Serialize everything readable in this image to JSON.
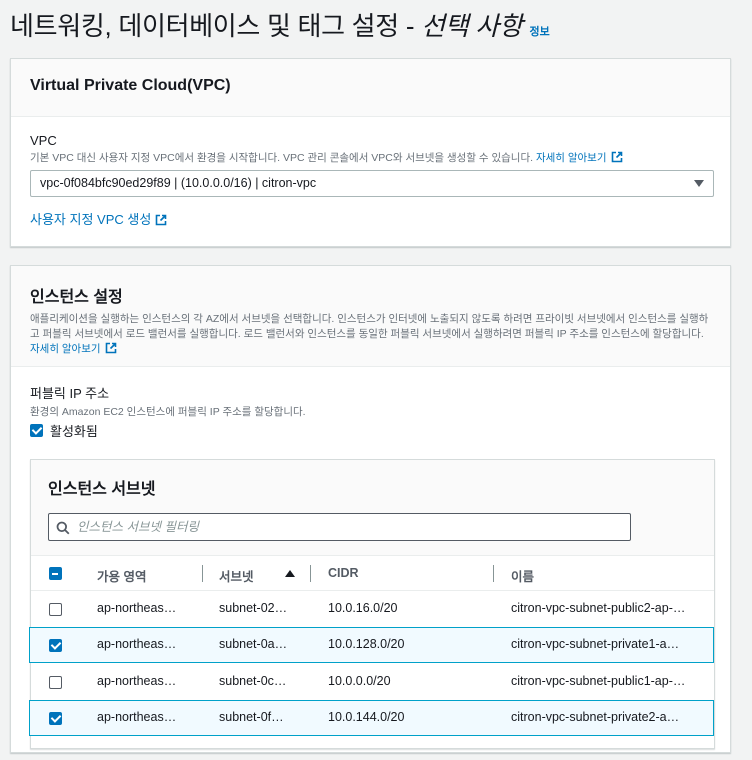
{
  "header": {
    "title_main": "네트워킹, 데이터베이스 및 태그 설정 - ",
    "title_optional": "선택 사항",
    "info_link": "정보"
  },
  "vpc_panel": {
    "title": "Virtual Private Cloud(VPC)",
    "field_label": "VPC",
    "description": "기본 VPC 대신 사용자 지정 VPC에서 환경을 시작합니다. VPC 관리 콘솔에서 VPC와 서브넷을 생성할 수 있습니다. ",
    "learn_more": "자세히 알아보기",
    "selected_vpc": "vpc-0f084bfc90ed29f89 | (10.0.0.0/16) | citron-vpc",
    "create_vpc_link": "사용자 지정 VPC 생성"
  },
  "instance_panel": {
    "title": "인스턴스 설정",
    "description": "애플리케이션을 실행하는 인스턴스의 각 AZ에서 서브넷을 선택합니다. 인스턴스가 인터넷에 노출되지 않도록 하려면 프라이빗 서브넷에서 인스턴스를 실행하고 퍼블릭 서브넷에서 로드 밸런서를 실행합니다. 로드 밸런서와 인스턴스를 동일한 퍼블릭 서브넷에서 실행하려면 퍼블릭 IP 주소를 인스턴스에 할당합니다. ",
    "learn_more": "자세히 알아보기",
    "public_ip_label": "퍼블릭 IP 주소",
    "public_ip_desc": "환경의 Amazon EC2 인스턴스에 퍼블릭 IP 주소를 할당합니다.",
    "activate_label": "활성화됨",
    "activate_checked": true
  },
  "subnet_table": {
    "title": "인스턴스 서브넷",
    "filter_placeholder": "인스턴스 서브넷 필터링",
    "columns": [
      "가용 영역",
      "서브넷",
      "CIDR",
      "이름"
    ],
    "sort_column": "서브넷",
    "sort_direction": "ascending",
    "rows": [
      {
        "az": "ap-northeas…",
        "subnet": "subnet-02…",
        "cidr": "10.0.16.0/20",
        "name": "citron-vpc-subnet-public2-ap-…",
        "selected": false
      },
      {
        "az": "ap-northeas…",
        "subnet": "subnet-0a…",
        "cidr": "10.0.128.0/20",
        "name": "citron-vpc-subnet-private1-a…",
        "selected": true
      },
      {
        "az": "ap-northeas…",
        "subnet": "subnet-0c…",
        "cidr": "10.0.0.0/20",
        "name": "citron-vpc-subnet-public1-ap-…",
        "selected": false
      },
      {
        "az": "ap-northeas…",
        "subnet": "subnet-0f…",
        "cidr": "10.0.144.0/20",
        "name": "citron-vpc-subnet-private2-a…",
        "selected": true
      }
    ]
  },
  "colors": {
    "link": "#0073bb",
    "selected_border": "#00a1c9",
    "selected_bg": "#f1faff"
  }
}
